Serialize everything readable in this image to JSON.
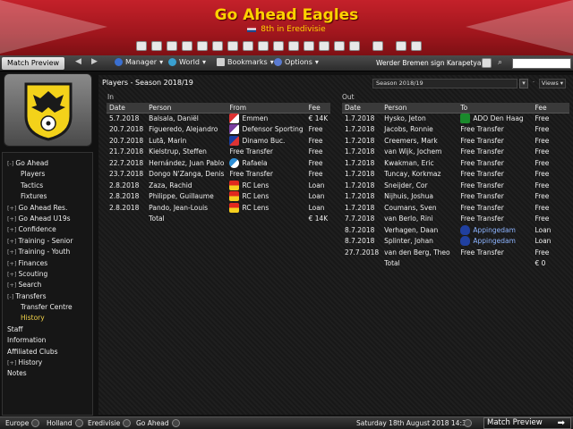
{
  "header": {
    "club_name": "Go Ahead Eagles",
    "league_position": "8th in Eredivisie",
    "primary_color": "#b81c24",
    "accent_color": "#ffd200"
  },
  "navbar": {
    "match_preview_label": "Match Preview",
    "menus": [
      "Manager",
      "World",
      "Bookmarks",
      "Options"
    ],
    "news_ticker": "Werder Bremen sign Karapetyan",
    "search_value": ""
  },
  "sidebar": {
    "items": [
      {
        "label": "Go Ahead",
        "expander": "[-]",
        "level": 0
      },
      {
        "label": "Players",
        "expander": "",
        "level": 1
      },
      {
        "label": "Tactics",
        "expander": "",
        "level": 1
      },
      {
        "label": "Fixtures",
        "expander": "",
        "level": 1
      },
      {
        "label": "Go Ahead Res.",
        "expander": "[+]",
        "level": 0
      },
      {
        "label": "Go Ahead U19s",
        "expander": "[+]",
        "level": 0
      },
      {
        "label": "Confidence",
        "expander": "[+]",
        "level": 0
      },
      {
        "label": "Training - Senior",
        "expander": "[+]",
        "level": 0
      },
      {
        "label": "Training - Youth",
        "expander": "[+]",
        "level": 0
      },
      {
        "label": "Finances",
        "expander": "[+]",
        "level": 0
      },
      {
        "label": "Scouting",
        "expander": "[+]",
        "level": 0
      },
      {
        "label": "Search",
        "expander": "[+]",
        "level": 0
      },
      {
        "label": "Transfers",
        "expander": "[-]",
        "level": 0
      },
      {
        "label": "Transfer Centre",
        "expander": "",
        "level": 1
      },
      {
        "label": "History",
        "expander": "",
        "level": 1,
        "active": true
      },
      {
        "label": "Staff",
        "expander": "",
        "level": 0
      },
      {
        "label": "Information",
        "expander": "",
        "level": 0
      },
      {
        "label": "Affiliated Clubs",
        "expander": "",
        "level": 0
      },
      {
        "label": "History",
        "expander": "[+]",
        "level": 0
      },
      {
        "label": "Notes",
        "expander": "",
        "level": 0
      }
    ]
  },
  "main": {
    "title": "Players - Season 2018/19",
    "season_selector": "Season 2018/19",
    "views_label": "Views",
    "in_label": "In",
    "out_label": "Out",
    "in_table": {
      "headers": [
        "Date",
        "Person",
        "From",
        "Fee"
      ],
      "rows": [
        {
          "date": "5.7.2018",
          "person": "Balsala, Daniël",
          "club": "Emmen",
          "badge": "emmen",
          "fee": "€ 14K"
        },
        {
          "date": "20.7.2018",
          "person": "Figueredo, Alejandro",
          "club": "Defensor Sporting",
          "badge": "defensor",
          "fee": "Free"
        },
        {
          "date": "20.7.2018",
          "person": "Lută, Marin",
          "club": "Dinamo Buc.",
          "badge": "dinamo",
          "fee": "Free"
        },
        {
          "date": "21.7.2018",
          "person": "Kielstrup, Steffen",
          "club": "Free Transfer",
          "badge": "",
          "fee": "Free"
        },
        {
          "date": "22.7.2018",
          "person": "Hernández, Juan Pablo",
          "club": "Rafaela",
          "badge": "rafaela",
          "fee": "Free"
        },
        {
          "date": "23.7.2018",
          "person": "Dongo N'Zanga, Denis",
          "club": "Free Transfer",
          "badge": "",
          "fee": "Free"
        },
        {
          "date": "2.8.2018",
          "person": "Zaza, Rachid",
          "club": "RC Lens",
          "badge": "lens",
          "fee": "Loan"
        },
        {
          "date": "2.8.2018",
          "person": "Philippe, Guillaume",
          "club": "RC Lens",
          "badge": "lens",
          "fee": "Loan"
        },
        {
          "date": "2.8.2018",
          "person": "Pando, Jean-Louis",
          "club": "RC Lens",
          "badge": "lens",
          "fee": "Loan"
        }
      ],
      "total_label": "Total",
      "total_value": "€ 14K"
    },
    "out_table": {
      "headers": [
        "Date",
        "Person",
        "To",
        "Fee"
      ],
      "rows": [
        {
          "date": "1.7.2018",
          "person": "Hysko, Jeton",
          "club": "ADO Den Haag",
          "badge": "ado",
          "fee": "Free"
        },
        {
          "date": "1.7.2018",
          "person": "Jacobs, Ronnie",
          "club": "Free Transfer",
          "badge": "",
          "fee": "Free"
        },
        {
          "date": "1.7.2018",
          "person": "Creemers, Mark",
          "club": "Free Transfer",
          "badge": "",
          "fee": "Free"
        },
        {
          "date": "1.7.2018",
          "person": "van Wijk, Jochem",
          "club": "Free Transfer",
          "badge": "",
          "fee": "Free"
        },
        {
          "date": "1.7.2018",
          "person": "Kwakman, Eric",
          "club": "Free Transfer",
          "badge": "",
          "fee": "Free"
        },
        {
          "date": "1.7.2018",
          "person": "Tuncay, Korkmaz",
          "club": "Free Transfer",
          "badge": "",
          "fee": "Free"
        },
        {
          "date": "1.7.2018",
          "person": "Sneijder, Cor",
          "club": "Free Transfer",
          "badge": "",
          "fee": "Free"
        },
        {
          "date": "1.7.2018",
          "person": "Nijhuis, Joshua",
          "club": "Free Transfer",
          "badge": "",
          "fee": "Free"
        },
        {
          "date": "1.7.2018",
          "person": "Coumans, Sven",
          "club": "Free Transfer",
          "badge": "",
          "fee": "Free"
        },
        {
          "date": "7.7.2018",
          "person": "van Berlo, Rini",
          "club": "Free Transfer",
          "badge": "",
          "fee": "Free"
        },
        {
          "date": "8.7.2018",
          "person": "Verhagen, Daan",
          "club": "Appingedam",
          "badge": "app",
          "fee": "Loan"
        },
        {
          "date": "8.7.2018",
          "person": "Splinter, Johan",
          "club": "Appingedam",
          "badge": "app",
          "fee": "Loan"
        },
        {
          "date": "27.7.2018",
          "person": "van den Berg, Theo",
          "club": "Free Transfer",
          "badge": "",
          "fee": "Free"
        }
      ],
      "total_label": "Total",
      "total_value": "€ 0"
    }
  },
  "bottombar": {
    "breadcrumbs": [
      "Europe",
      "Holland",
      "Eredivisie",
      "Go Ahead"
    ],
    "date_time": "Saturday 18th August 2018 14:30",
    "continue_label": "Match Preview"
  }
}
